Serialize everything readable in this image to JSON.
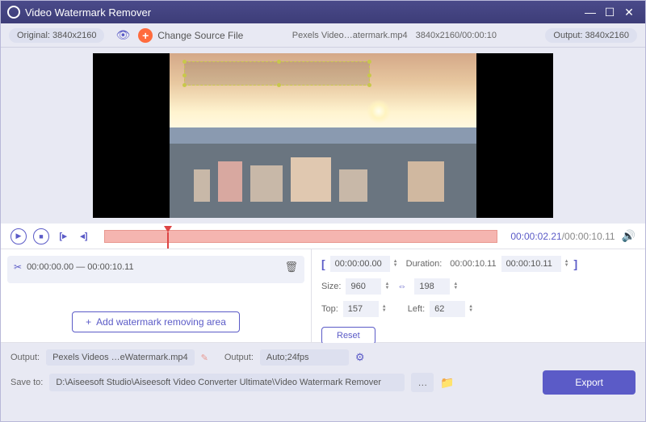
{
  "titlebar": {
    "title": "Video Watermark Remover"
  },
  "toolbar": {
    "original_label": "Original: 3840x2160",
    "change_source": "Change Source File",
    "filename": "Pexels Video…atermark.mp4",
    "resolution_time": "3840x2160/00:00:10",
    "output_label": "Output: 3840x2160"
  },
  "transport": {
    "current": "00:00:02.21",
    "total": "/00:00:10.11"
  },
  "area": {
    "range": "00:00:00.00 — 00:00:10.11"
  },
  "add_area_label": "Add watermark removing area",
  "trim": {
    "start": "00:00:00.00",
    "duration_label": "Duration:",
    "duration": "00:00:10.11",
    "end": "00:00:10.11"
  },
  "size": {
    "label": "Size:",
    "w": "960",
    "h": "198"
  },
  "pos": {
    "top_label": "Top:",
    "top": "157",
    "left_label": "Left:",
    "left": "62"
  },
  "reset_label": "Reset",
  "output": {
    "label": "Output:",
    "filename": "Pexels Videos …eWatermark.mp4",
    "fmt_label": "Output:",
    "fmt": "Auto;24fps"
  },
  "save": {
    "label": "Save to:",
    "path": "D:\\Aiseesoft Studio\\Aiseesoft Video Converter Ultimate\\Video Watermark Remover"
  },
  "export_label": "Export"
}
